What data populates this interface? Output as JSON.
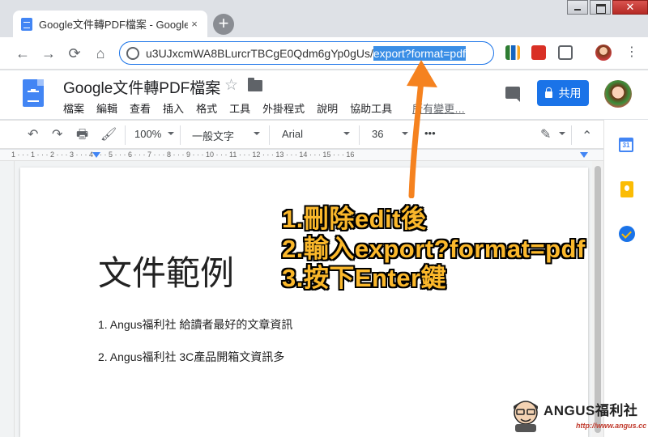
{
  "browser": {
    "tab_title": "Google文件轉PDF檔案 - Google",
    "tab_close": "×",
    "new_tab": "+",
    "window_close": "✕",
    "back": "←",
    "forward": "→",
    "reload": "⟳",
    "home": "⌂",
    "url_prefix": "u3UJxcmWA8BLurcrTBCgE0Qdm6gYp0gUs/",
    "url_selected": "export?format=pdf",
    "menu": "⋮"
  },
  "docs": {
    "title": "Google文件轉PDF檔案",
    "star": "☆",
    "menu": [
      "檔案",
      "編輯",
      "查看",
      "插入",
      "格式",
      "工具",
      "外掛程式",
      "說明",
      "協助工具"
    ],
    "last_edit": "所有變更…",
    "share_label": "共用"
  },
  "format_bar": {
    "undo": "↶",
    "redo": "↷",
    "print": "🖶",
    "paint": "🖌",
    "zoom": "100%",
    "style": "一般文字",
    "font": "Arial",
    "size": "36",
    "more": "•••",
    "edit_mode": "✎",
    "collapse": "⌃"
  },
  "ruler": {
    "labels": "1 · · · 1 · · · 2 · · · 3 · · · 4 · · · 5 · · · 6 · · · 7 · · · 8 · · · 9 · · · 10 · · · 11 · · · 12 · · · 13 · · · 14 · · · 15 · · · 16"
  },
  "document": {
    "heading": "文件範例",
    "items": [
      "1. Angus福利社 給讀者最好的文章資訊",
      "2. Angus福利社 3C產品開箱文資訊多"
    ]
  },
  "side_panel": {
    "calendar_day": "31"
  },
  "annotation": {
    "steps": [
      "1.刪除edit後",
      "2.輸入export?format=pdf",
      "3.按下Enter鍵"
    ],
    "color": "#fbb82b",
    "arrow_color": "#f5821f"
  },
  "watermark": {
    "name": "ANGUS福利社",
    "url": "http://www.angus.cc"
  }
}
